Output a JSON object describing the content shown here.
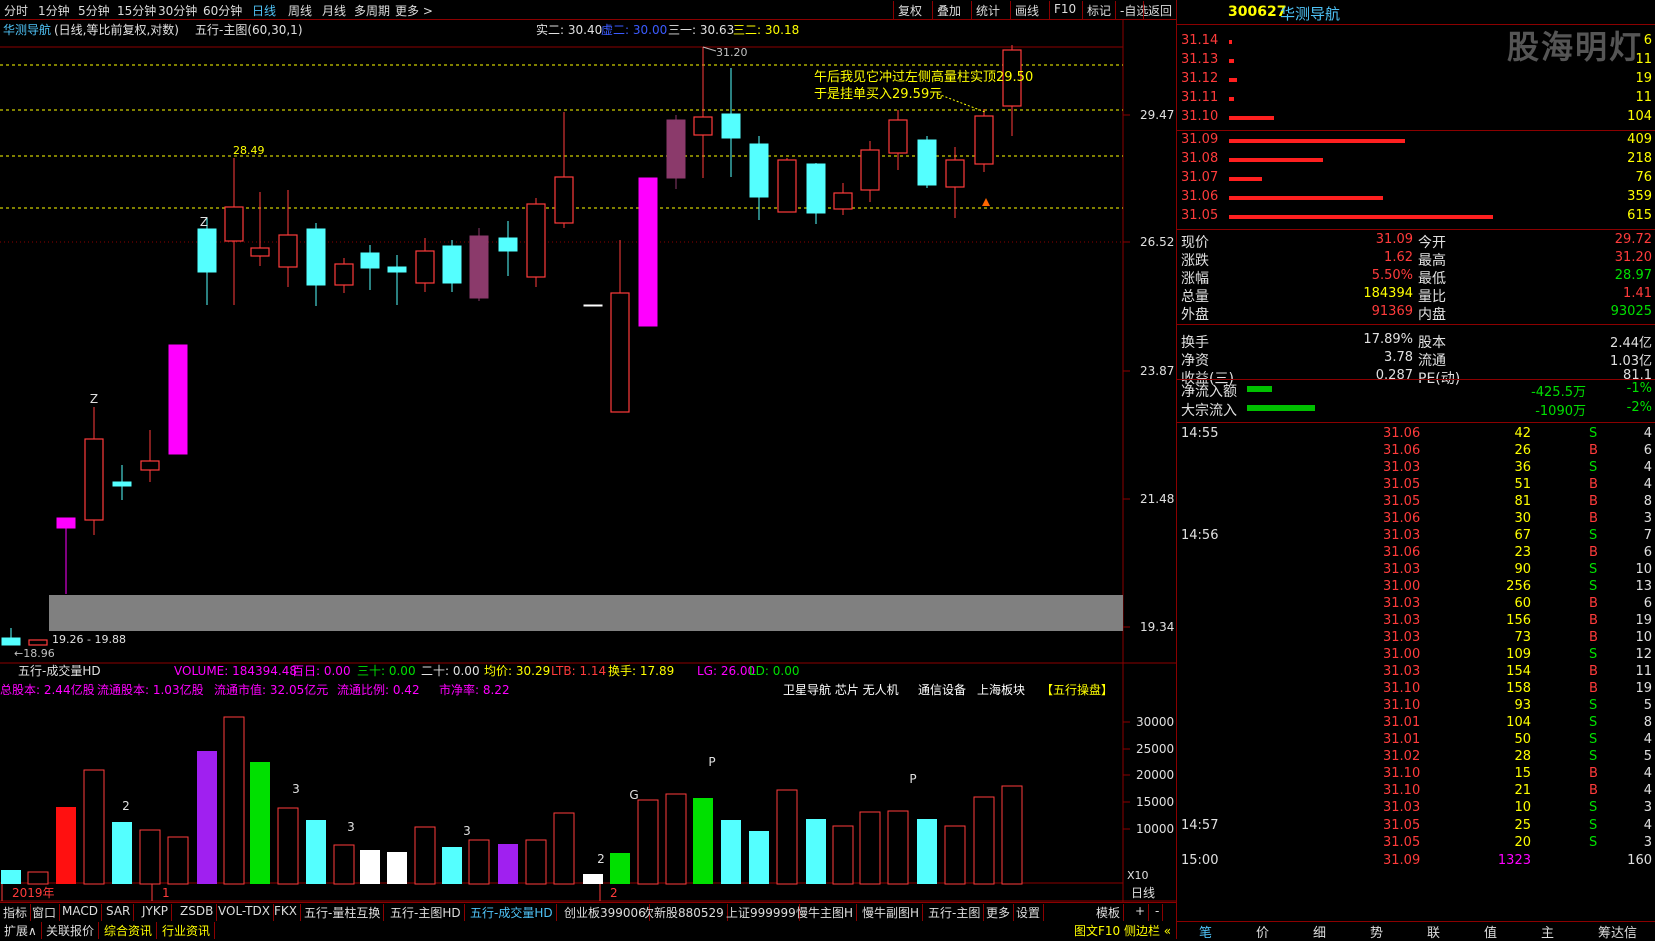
{
  "periods": [
    "分时",
    "1分钟",
    "5分钟",
    "15分钟",
    "30分钟",
    "60分钟",
    "日线",
    "周线",
    "月线",
    "多周期",
    "更多 >"
  ],
  "active_period": "日线",
  "toolbar": [
    "复权",
    "叠加",
    "统计",
    "画线",
    "F10",
    "标记",
    "-自选",
    "返回"
  ],
  "title_bar": {
    "name": "华测导航",
    "mode": "(日线,等比前复权,对数)",
    "indicator": "五行-主图(60,30,1)"
  },
  "ma_labels": [
    {
      "text": "实二: 30.40",
      "color": "#e0e0e0"
    },
    {
      "text": "虚二: 30.00",
      "color": "#3b5bff"
    },
    {
      "text": "三一: 30.63",
      "color": "#e0e0e0"
    },
    {
      "text": "三二: 30.18",
      "color": "#ffff00"
    }
  ],
  "annotation": {
    "line1": "午后我见它冲过左侧高量柱实顶29.50",
    "line2": "于是挂单买入29.59元"
  },
  "price_axis": [
    "29.47",
    "26.52",
    "23.87",
    "21.48",
    "19.34"
  ],
  "price_marks": {
    "high": "31.20",
    "low": "18.96",
    "range": "19.26 - 19.88",
    "level": "28.49"
  },
  "candle_letters": [
    "Z",
    "Z"
  ],
  "date_labels": [
    "2019年",
    "1",
    "2"
  ],
  "vol_header": {
    "title": "五行-成交量HD",
    "items": [
      {
        "text": "VOLUME: 184394.48",
        "color": "#ff00ff"
      },
      {
        "text": "百日: 0.00",
        "color": "#ff00ff"
      },
      {
        "text": "三十: 0.00",
        "color": "#00e000"
      },
      {
        "text": "二十: 0.00",
        "color": "#e0e0e0"
      },
      {
        "text": "均价: 30.29",
        "color": "#ffff00"
      },
      {
        "text": "LTB: 1.14",
        "color": "#ff3b3b"
      },
      {
        "text": "换手: 17.89",
        "color": "#ffff00"
      },
      {
        "text": "LG: 26.00",
        "color": "#ff00ff"
      },
      {
        "text": "LD: 0.00",
        "color": "#00e000"
      }
    ]
  },
  "vol_info": [
    {
      "text": "总股本: 2.44亿股",
      "color": "#ff00ff"
    },
    {
      "text": "流通股本: 1.03亿股",
      "color": "#ff00ff"
    },
    {
      "text": "流通市值: 32.05亿元",
      "color": "#ff00ff"
    },
    {
      "text": "流通比例: 0.42",
      "color": "#ff00ff"
    },
    {
      "text": "市净率: 8.22",
      "color": "#ff00ff"
    }
  ],
  "sectors": [
    "卫星导航 芯片 无人机",
    "通信设备",
    "上海板块"
  ],
  "sector_tag": "【五行操盘】",
  "vol_axis": [
    "30000",
    "25000",
    "20000",
    "15000",
    "10000"
  ],
  "vol_unit": "X10",
  "vol_letters": [
    "2",
    "3",
    "3",
    "3",
    "2",
    "G",
    "P",
    "P"
  ],
  "bottom_tabs": [
    "指标",
    "窗口",
    "MACD",
    "SAR",
    "JYKP",
    "ZSDB",
    "VOL-TDX",
    "FKX",
    "五行-量柱互换",
    "五行-主图HD",
    "五行-成交量HD",
    "创业板399006",
    "次新股880529",
    "上证999999",
    "慢牛主图H",
    "慢牛副图H",
    "五行-主图",
    "更多",
    "设置"
  ],
  "active_bottom_tab": "五行-成交量HD",
  "axis_mode": "日线",
  "bottom_right": [
    "模板",
    "+",
    "-"
  ],
  "ext_tabs": [
    "扩展∧",
    "关联报价",
    "综合资讯",
    "行业资讯"
  ],
  "ext_right": "图文F10 侧边栏 «",
  "quote": {
    "code": "300627",
    "name": "华测导航",
    "watermark": "股海明灯",
    "asks": [
      [
        "31.14",
        "6"
      ],
      [
        "31.13",
        "11"
      ],
      [
        "31.12",
        "19"
      ],
      [
        "31.11",
        "11"
      ],
      [
        "31.10",
        "104"
      ]
    ],
    "bids": [
      [
        "31.09",
        "409"
      ],
      [
        "31.08",
        "218"
      ],
      [
        "31.07",
        "76"
      ],
      [
        "31.06",
        "359"
      ],
      [
        "31.05",
        "615"
      ]
    ],
    "stats": [
      [
        "现价",
        "31.09",
        "今开",
        "29.72"
      ],
      [
        "涨跌",
        "1.62",
        "最高",
        "31.20"
      ],
      [
        "涨幅",
        "5.50%",
        "最低",
        "28.97"
      ],
      [
        "总量",
        "184394",
        "量比",
        "1.41"
      ],
      [
        "外盘",
        "91369",
        "内盘",
        "93025"
      ],
      [
        "换手",
        "17.89%",
        "股本",
        "2.44亿"
      ],
      [
        "净资",
        "3.78",
        "流通",
        "1.03亿"
      ],
      [
        "收益(三)",
        "0.287",
        "PE(动)",
        "81.1"
      ]
    ],
    "flows": [
      [
        "净流入额",
        "-425.5万",
        "-1%"
      ],
      [
        "大宗流入",
        "-1090万",
        "-2%"
      ]
    ],
    "ticks": [
      [
        "14:55",
        "31.06",
        "42",
        "S",
        "4"
      ],
      [
        "",
        "31.06",
        "26",
        "B",
        "6"
      ],
      [
        "",
        "31.03",
        "36",
        "S",
        "4"
      ],
      [
        "",
        "31.05",
        "51",
        "B",
        "4"
      ],
      [
        "",
        "31.05",
        "81",
        "B",
        "8"
      ],
      [
        "",
        "31.06",
        "30",
        "B",
        "3"
      ],
      [
        "14:56",
        "31.03",
        "67",
        "S",
        "7"
      ],
      [
        "",
        "31.06",
        "23",
        "B",
        "6"
      ],
      [
        "",
        "31.03",
        "90",
        "S",
        "10"
      ],
      [
        "",
        "31.00",
        "256",
        "S",
        "13"
      ],
      [
        "",
        "31.03",
        "60",
        "B",
        "6"
      ],
      [
        "",
        "31.03",
        "156",
        "B",
        "19"
      ],
      [
        "",
        "31.03",
        "73",
        "B",
        "10"
      ],
      [
        "",
        "31.00",
        "109",
        "S",
        "12"
      ],
      [
        "",
        "31.03",
        "154",
        "B",
        "11"
      ],
      [
        "",
        "31.10",
        "158",
        "B",
        "19"
      ],
      [
        "",
        "31.10",
        "93",
        "S",
        "5"
      ],
      [
        "",
        "31.01",
        "104",
        "S",
        "8"
      ],
      [
        "",
        "31.01",
        "50",
        "S",
        "4"
      ],
      [
        "",
        "31.02",
        "28",
        "S",
        "5"
      ],
      [
        "",
        "31.10",
        "15",
        "B",
        "4"
      ],
      [
        "",
        "31.10",
        "21",
        "B",
        "4"
      ],
      [
        "",
        "31.03",
        "10",
        "S",
        "3"
      ],
      [
        "14:57",
        "31.05",
        "25",
        "S",
        "4"
      ],
      [
        "",
        "31.05",
        "20",
        "S",
        "3"
      ],
      [
        "15:00",
        "31.09",
        "1323",
        "",
        "160"
      ]
    ],
    "tabs": [
      "笔",
      "价",
      "细",
      "势",
      "联",
      "值",
      "主",
      "筹达信"
    ]
  }
}
